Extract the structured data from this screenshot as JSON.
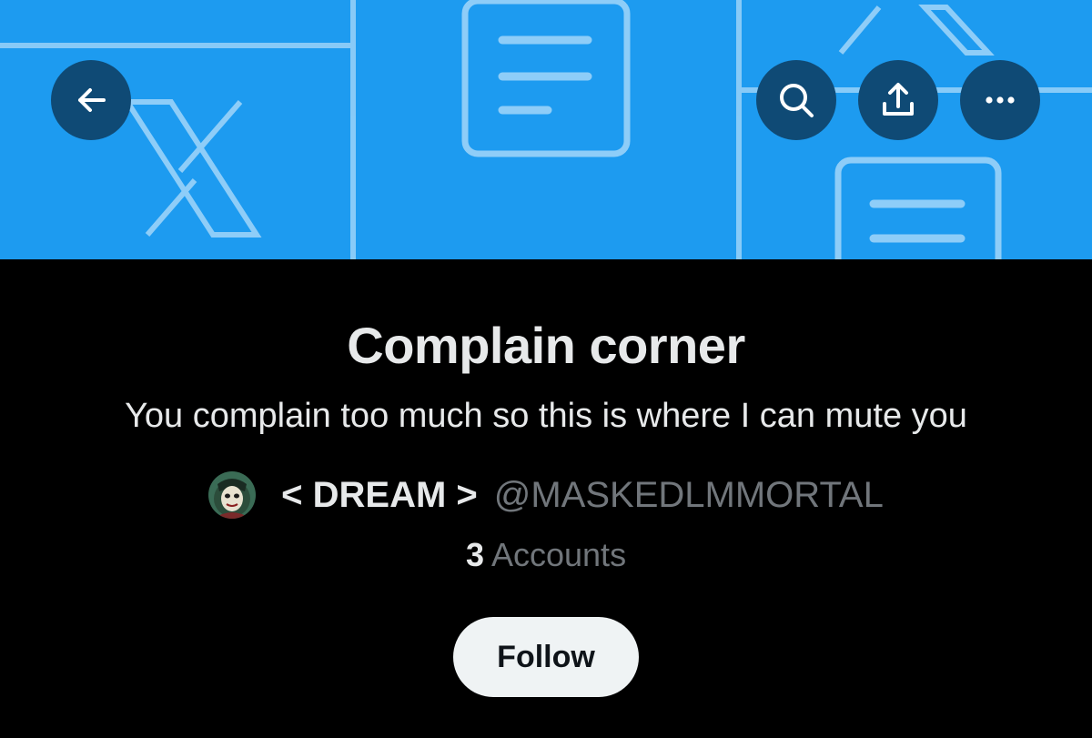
{
  "banner": {
    "background_color": "#1d9bf0",
    "pattern_color": "#8ecdf8",
    "pattern_icons": [
      "x-logo-icon",
      "document-icon"
    ]
  },
  "topbar": {
    "back_icon": "arrow-left-icon",
    "search_icon": "search-icon",
    "share_icon": "share-icon",
    "more_icon": "more-horizontal-icon",
    "button_background": "#0f4a75"
  },
  "list": {
    "title": "Complain corner",
    "description": "You complain too much so this is where I can mute you",
    "owner": {
      "display_name": "< DREAM >",
      "handle": "@MASKEDLMMORTAL",
      "avatar_icon": "avatar-mask-icon"
    },
    "members": {
      "count": "3",
      "label": "Accounts"
    }
  },
  "follow_button": {
    "label": "Follow",
    "background": "#eff3f4",
    "text_color": "#0f1419"
  },
  "colors": {
    "page_background": "#000000",
    "primary_text": "#e7e9ea",
    "secondary_text": "#71767b"
  }
}
